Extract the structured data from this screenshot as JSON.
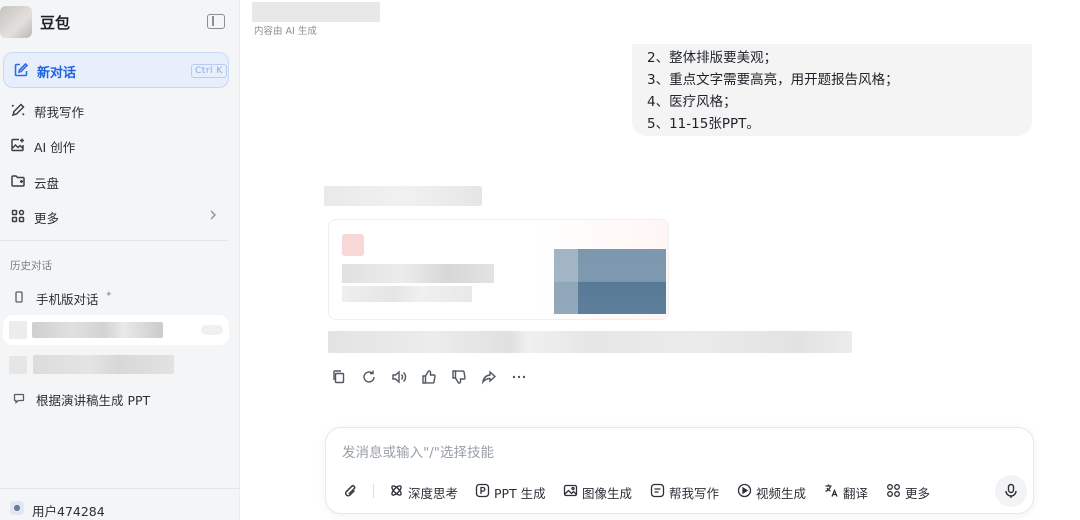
{
  "sidebar": {
    "brand": "豆包",
    "new_chat": {
      "label": "新对话",
      "shortcut": "Ctrl K"
    },
    "nav": [
      {
        "label": "帮我写作",
        "icon": "pen-icon"
      },
      {
        "label": "AI 创作",
        "icon": "image-spark-icon"
      },
      {
        "label": "云盘",
        "icon": "cloud-drive-icon"
      },
      {
        "label": "更多",
        "icon": "apps-grid-icon"
      }
    ],
    "history_title": "历史对话",
    "history": [
      {
        "label": "手机版对话",
        "icon": "phone-icon",
        "pinned": true
      },
      {
        "label": "根据演讲稿生成 PPT",
        "icon": "chat-bubble-icon"
      }
    ],
    "user": "用户474284"
  },
  "main": {
    "ai_note": "内容由 AI 生成",
    "user_message_lines": [
      "2、整体排版要美观；",
      "3、重点文字需要高亮，用开题报告风格；",
      "4、医疗风格；",
      "5、11-15张PPT。"
    ]
  },
  "composer": {
    "placeholder": "发消息或输入\"/\"选择技能",
    "tools": [
      {
        "label": "深度思考",
        "icon": "atom-icon"
      },
      {
        "label": "PPT 生成",
        "icon": "ppt-icon"
      },
      {
        "label": "图像生成",
        "icon": "image-icon"
      },
      {
        "label": "帮我写作",
        "icon": "writing-icon"
      },
      {
        "label": "视频生成",
        "icon": "video-icon"
      },
      {
        "label": "翻译",
        "icon": "translate-icon"
      },
      {
        "label": "更多",
        "icon": "grid-icon"
      }
    ]
  },
  "colors": {
    "accent": "#1f63e0",
    "accent_bg": "#e7eefc",
    "sidebar_bg": "#f4f5f7",
    "bubble_bg": "#f4f4f5"
  }
}
